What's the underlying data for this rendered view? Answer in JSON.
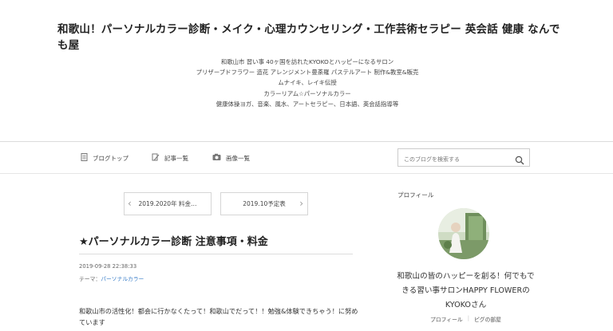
{
  "blog": {
    "title": "和歌山！パーソナルカラー診断・メイク・心理カウンセリング・工作芸術セラピー 英会話 健康 なんでも屋",
    "description_lines": [
      "和歌山市 習い事 40ヶ国を訪れたKYOKOとハッピーになるサロン",
      "プリザーブドフラワー 造花 アレンジメント曼荼羅 パステルアート 制作&教室&販売",
      "ムナイキ、レイキ伝授",
      "カラーリアム☆パーソナルカラー",
      "健康体操ヨガ、音楽、風水、アートセラピー、日本語、英会話指導等"
    ]
  },
  "nav": {
    "home": {
      "label": "ブログトップ",
      "icon": "document-icon"
    },
    "entries": {
      "label": "記事一覧",
      "icon": "entries-icon"
    },
    "images": {
      "label": "画像一覧",
      "icon": "camera-icon"
    }
  },
  "search": {
    "placeholder": "このブログを検索する",
    "icon": "search-icon"
  },
  "pager": {
    "prev": "2019.2020年 料金…",
    "next": "2019.10予定表"
  },
  "entry": {
    "title": "★パーソナルカラー診断 注意事項・料金",
    "datetime": "2019-09-28 22:38:33",
    "theme_label": "テーマ：",
    "theme_value": "パーソナルカラー",
    "body": "和歌山市の活性化！都会に行かなくたって！和歌山でだって！！勉強&体験できちゃう！に努めています"
  },
  "sidebar": {
    "heading": "プロフィール",
    "profile_name": "和歌山の皆のハッピーを創る！何でもできる習い事サロンHAPPY FLOWERのKYOKOさん",
    "links": [
      "プロフィール",
      "ピグの部屋"
    ]
  },
  "colors": {
    "link": "#3a7ec8",
    "border": "#dcdcdc",
    "text": "#333333"
  }
}
